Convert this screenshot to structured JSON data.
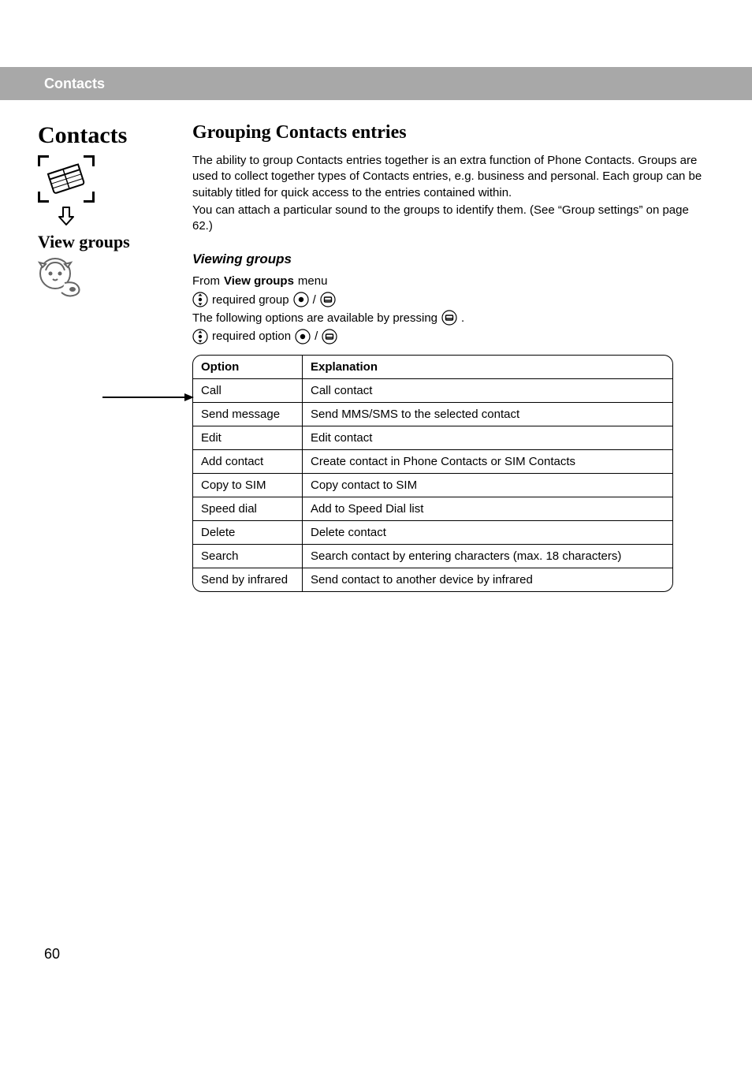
{
  "header": {
    "section": "Contacts"
  },
  "sidebar": {
    "title": "Contacts",
    "subheading": "View groups"
  },
  "main": {
    "title": "Grouping Contacts entries",
    "para1": "The ability to group Contacts entries together is an extra function of Phone Contacts. Groups are used to collect together types of Contacts entries, e.g. business and personal. Each group can be suitably titled for quick access to the entries contained within.",
    "para2": "You can attach a particular sound to the groups to identify them. (See “Group settings” on page 62.)",
    "subheading": "Viewing groups",
    "line_from": "From ",
    "line_from_bold": "View groups",
    "line_from_tail": " menu",
    "line_req_group": " required group ",
    "line_slash": " / ",
    "line_following": "The following options are available by pressing ",
    "line_following_tail": ".",
    "line_req_option": " required option ",
    "table": {
      "headers": {
        "option": "Option",
        "explanation": "Explanation"
      },
      "rows": [
        {
          "option": "Call",
          "explanation": "Call contact"
        },
        {
          "option": "Send message",
          "explanation": "Send MMS/SMS to the selected contact"
        },
        {
          "option": "Edit",
          "explanation": "Edit contact"
        },
        {
          "option": "Add contact",
          "explanation": "Create contact in Phone Contacts or SIM Contacts"
        },
        {
          "option": "Copy to SIM",
          "explanation": "Copy contact to SIM"
        },
        {
          "option": "Speed dial",
          "explanation": "Add to Speed Dial list"
        },
        {
          "option": "Delete",
          "explanation": "Delete contact"
        },
        {
          "option": "Search",
          "explanation": "Search contact by entering characters (max. 18 characters)"
        },
        {
          "option": "Send by infrared",
          "explanation": "Send contact to another device by infrared"
        }
      ]
    }
  },
  "page_number": "60"
}
